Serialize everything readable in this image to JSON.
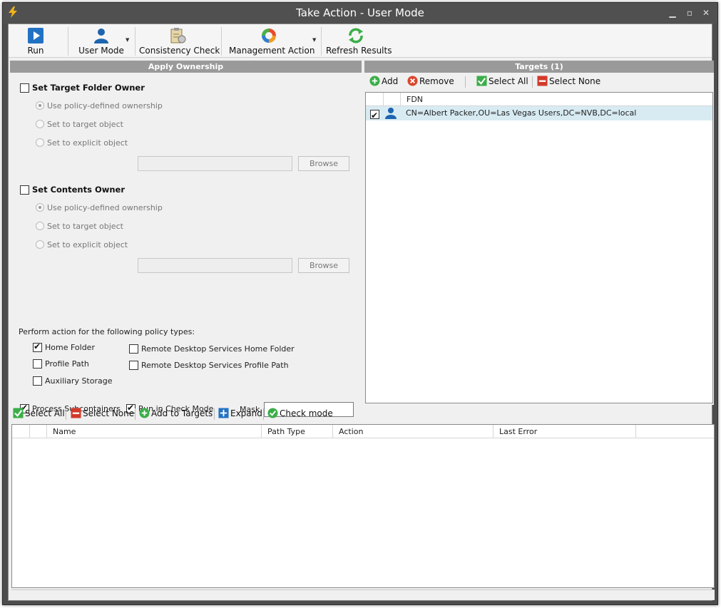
{
  "window": {
    "title": "Take Action - User Mode"
  },
  "toolbar": {
    "run": "Run",
    "user_mode": "User Mode",
    "consistency_check": "Consistency Check",
    "management_action": "Management Action",
    "refresh_results": "Refresh Results"
  },
  "apply_ownership": {
    "header": "Apply Ownership",
    "target_folder_owner": {
      "label": "Set Target Folder Owner",
      "checked": false,
      "options": [
        "Use policy-defined ownership",
        "Set to target object",
        "Set to explicit object"
      ],
      "selected": 0,
      "browse": "Browse"
    },
    "contents_owner": {
      "label": "Set Contents Owner",
      "checked": false,
      "options": [
        "Use policy-defined ownership",
        "Set to target object",
        "Set to explicit object"
      ],
      "selected": 0,
      "browse": "Browse"
    },
    "policy_types_label": "Perform action for the following policy types:",
    "policy_types": [
      {
        "label": "Home Folder",
        "checked": true
      },
      {
        "label": "Profile Path",
        "checked": false
      },
      {
        "label": "Auxiliary Storage",
        "checked": false
      },
      {
        "label": "Remote Desktop Services Home Folder",
        "checked": false
      },
      {
        "label": "Remote Desktop Services Profile Path",
        "checked": false
      }
    ],
    "process_subcontainers": {
      "label": "Process Subcontainers",
      "checked": true
    },
    "run_in_check_mode": {
      "label": "Run in Check Mode",
      "checked": true
    },
    "mask_label": "Mask",
    "mask_value": ""
  },
  "targets": {
    "header": "Targets  (1)",
    "toolbar": {
      "add": "Add",
      "remove": "Remove",
      "select_all": "Select All",
      "select_none": "Select None"
    },
    "columns": [
      "FDN"
    ],
    "rows": [
      {
        "checked": true,
        "fdn": "CN=Albert Packer,OU=Las Vegas Users,DC=NVB,DC=local"
      }
    ]
  },
  "results": {
    "toolbar": {
      "select_all": "Select All",
      "select_none": "Select None",
      "add_to_targets": "Add to Targets",
      "expand": "Expand",
      "check_mode": "Check mode"
    },
    "columns": [
      "Name",
      "Path Type",
      "Action",
      "Last Error"
    ]
  },
  "colors": {
    "accent_blue": "#1e6fc0",
    "green": "#3bae49",
    "red": "#d23a2a",
    "header_gray": "#9a9a9a",
    "selected_row": "#d8ebf3"
  }
}
